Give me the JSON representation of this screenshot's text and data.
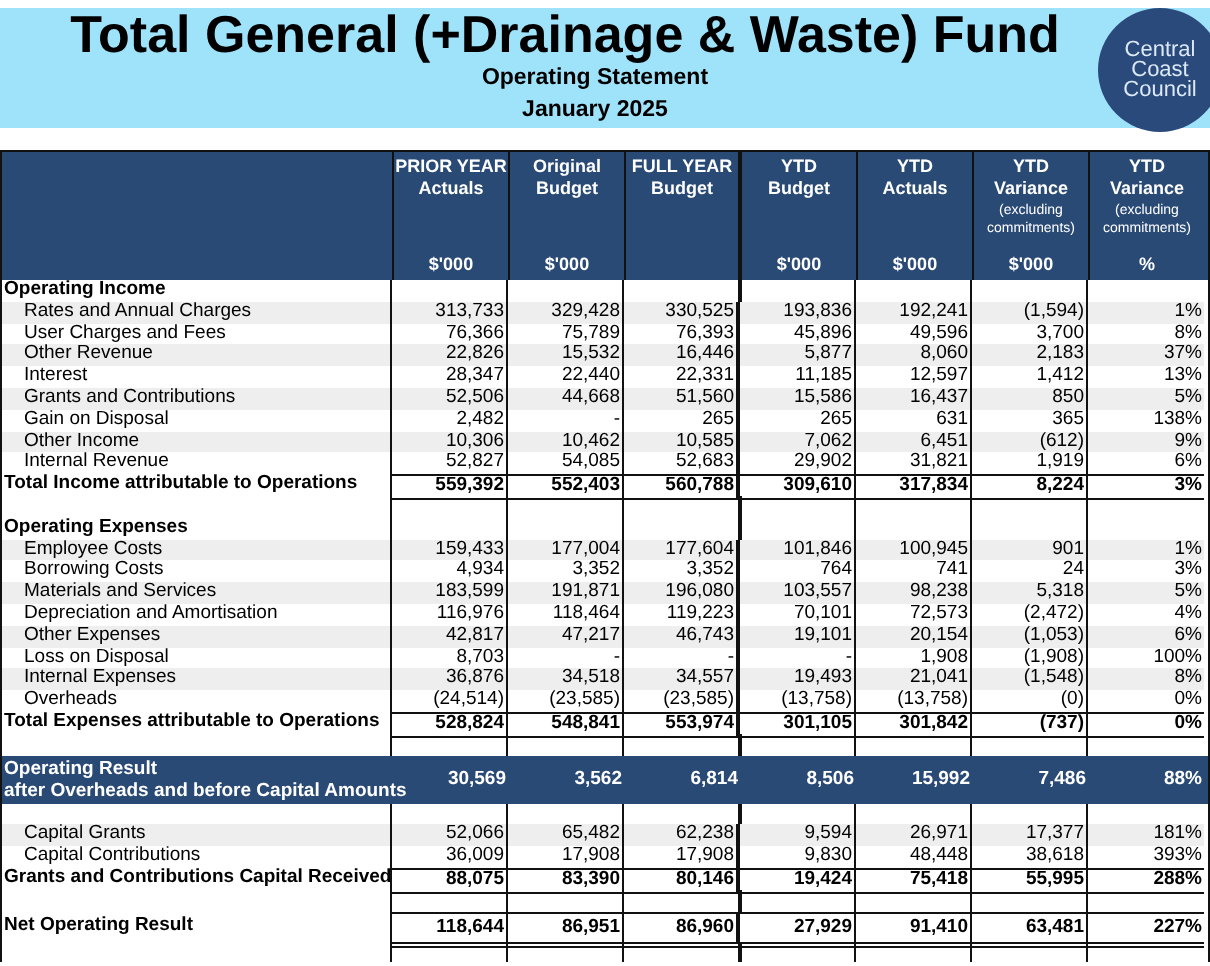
{
  "title": "Total General (+Drainage & Waste) Fund",
  "subtitle": "Operating Statement",
  "period": "January 2025",
  "logo": {
    "lines": [
      "Central",
      "Coast",
      "Council"
    ]
  },
  "columns": [
    {
      "title": [
        "PRIOR YEAR",
        "Actuals"
      ],
      "unit": "$'000"
    },
    {
      "title": [
        "Original",
        "Budget"
      ],
      "unit": "$'000"
    },
    {
      "title": [
        "FULL YEAR",
        "Budget"
      ]
    },
    {
      "title": [
        "YTD",
        "Budget"
      ],
      "unit": "$'000"
    },
    {
      "title": [
        "YTD",
        "Actuals"
      ],
      "unit": "$'000"
    },
    {
      "title": [
        "YTD",
        "Variance"
      ],
      "note": "(excluding commitments)",
      "unit": "$'000"
    },
    {
      "title": [
        "YTD",
        "Variance"
      ],
      "note": "(excluding commitments)",
      "unit": "%"
    }
  ],
  "rows": [
    {
      "kind": "section",
      "label": "Operating Income"
    },
    {
      "kind": "item",
      "label": "Rates and Annual Charges",
      "values": [
        "313,733",
        "329,428",
        "330,525",
        "193,836",
        "192,241",
        "(1,594)",
        "1%"
      ]
    },
    {
      "kind": "item",
      "label": "User Charges and Fees",
      "values": [
        "76,366",
        "75,789",
        "76,393",
        "45,896",
        "49,596",
        "3,700",
        "8%"
      ]
    },
    {
      "kind": "item",
      "label": "Other Revenue",
      "values": [
        "22,826",
        "15,532",
        "16,446",
        "5,877",
        "8,060",
        "2,183",
        "37%"
      ]
    },
    {
      "kind": "item",
      "label": "Interest",
      "values": [
        "28,347",
        "22,440",
        "22,331",
        "11,185",
        "12,597",
        "1,412",
        "13%"
      ]
    },
    {
      "kind": "item",
      "label": "Grants and Contributions",
      "values": [
        "52,506",
        "44,668",
        "51,560",
        "15,586",
        "16,437",
        "850",
        "5%"
      ]
    },
    {
      "kind": "item",
      "label": "Gain on Disposal",
      "values": [
        "2,482",
        "-",
        "265",
        "265",
        "631",
        "365",
        "138%"
      ]
    },
    {
      "kind": "item",
      "label": "Other Income",
      "values": [
        "10,306",
        "10,462",
        "10,585",
        "7,062",
        "6,451",
        "(612)",
        "9%"
      ]
    },
    {
      "kind": "item",
      "label": "Internal Revenue",
      "values": [
        "52,827",
        "54,085",
        "52,683",
        "29,902",
        "31,821",
        "1,919",
        "6%"
      ]
    },
    {
      "kind": "total",
      "label": "Total Income attributable to Operations",
      "values": [
        "559,392",
        "552,403",
        "560,788",
        "309,610",
        "317,834",
        "8,224",
        "3%"
      ]
    },
    {
      "kind": "blank"
    },
    {
      "kind": "section",
      "label": "Operating Expenses"
    },
    {
      "kind": "item",
      "label": "Employee Costs",
      "values": [
        "159,433",
        "177,004",
        "177,604",
        "101,846",
        "100,945",
        "901",
        "1%"
      ]
    },
    {
      "kind": "item",
      "label": "Borrowing Costs",
      "values": [
        "4,934",
        "3,352",
        "3,352",
        "764",
        "741",
        "24",
        "3%"
      ]
    },
    {
      "kind": "item",
      "label": "Materials and Services",
      "values": [
        "183,599",
        "191,871",
        "196,080",
        "103,557",
        "98,238",
        "5,318",
        "5%"
      ]
    },
    {
      "kind": "item",
      "label": "Depreciation and Amortisation",
      "values": [
        "116,976",
        "118,464",
        "119,223",
        "70,101",
        "72,573",
        "(2,472)",
        "4%"
      ]
    },
    {
      "kind": "item",
      "label": "Other Expenses",
      "values": [
        "42,817",
        "47,217",
        "46,743",
        "19,101",
        "20,154",
        "(1,053)",
        "6%"
      ]
    },
    {
      "kind": "item",
      "label": "Loss on Disposal",
      "values": [
        "8,703",
        "-",
        "-",
        "-",
        "1,908",
        "(1,908)",
        "100%"
      ]
    },
    {
      "kind": "item",
      "label": "Internal Expenses",
      "values": [
        "36,876",
        "34,518",
        "34,557",
        "19,493",
        "21,041",
        "(1,548)",
        "8%"
      ]
    },
    {
      "kind": "item",
      "label": "Overheads",
      "values": [
        "(24,514)",
        "(23,585)",
        "(23,585)",
        "(13,758)",
        "(13,758)",
        "(0)",
        "0%"
      ]
    },
    {
      "kind": "total",
      "label": "Total Expenses attributable to Operations",
      "values": [
        "528,824",
        "548,841",
        "553,974",
        "301,105",
        "301,842",
        "(737)",
        "0%"
      ]
    },
    {
      "kind": "blank"
    },
    {
      "kind": "result",
      "label": [
        "Operating Result",
        "after Overheads and before Capital Amounts"
      ],
      "values": [
        "30,569",
        "3,562",
        "6,814",
        "8,506",
        "15,992",
        "7,486",
        "88%"
      ]
    },
    {
      "kind": "blank"
    },
    {
      "kind": "item",
      "label": "Capital Grants",
      "values": [
        "52,066",
        "65,482",
        "62,238",
        "9,594",
        "26,971",
        "17,377",
        "181%"
      ]
    },
    {
      "kind": "item",
      "label": "Capital Contributions",
      "values": [
        "36,009",
        "17,908",
        "17,908",
        "9,830",
        "48,448",
        "38,618",
        "393%"
      ]
    },
    {
      "kind": "total",
      "label": "Grants and Contributions Capital Received",
      "values": [
        "88,075",
        "83,390",
        "80,146",
        "19,424",
        "75,418",
        "55,995",
        "288%"
      ]
    },
    {
      "kind": "blank"
    },
    {
      "kind": "net",
      "label": "Net Operating Result",
      "values": [
        "118,644",
        "86,951",
        "86,960",
        "27,929",
        "91,410",
        "63,481",
        "227%"
      ]
    },
    {
      "kind": "blank"
    }
  ]
}
